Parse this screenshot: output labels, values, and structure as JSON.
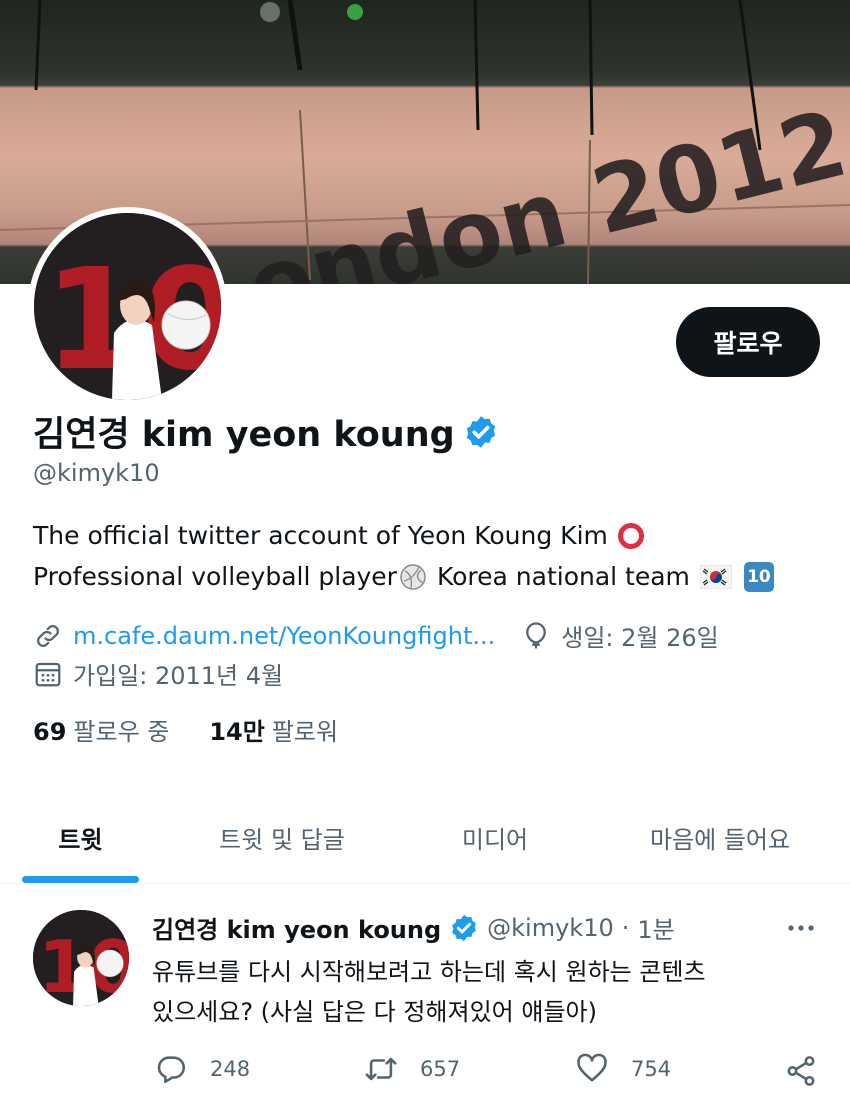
{
  "banner": {
    "text": "London 2012"
  },
  "profile": {
    "avatar_number": "10",
    "follow_label": "팔로우",
    "display_name": "김연경 kim yeon koung",
    "handle": "@kimyk10",
    "bio_line1": "The official twitter account of Yeon Koung Kim",
    "bio_line2a": "Professional volleyball player",
    "bio_line2b": "Korea national team",
    "bio_emoji_ten": "10",
    "website": "m.cafe.daum.net/YeonKoungfight...",
    "birthday": "생일: 2월 26일",
    "joined": "가입일: 2011년 4월",
    "following_count": "69",
    "following_label": "팔로우 중",
    "followers_count": "14만",
    "followers_label": "팔로워"
  },
  "tabs": [
    "트윗",
    "트윗 및 답글",
    "미디어",
    "마음에 들어요"
  ],
  "tweet": {
    "author": "김연경 kim yeon koung",
    "handle": "@kimyk10",
    "dot": "·",
    "time": "1분",
    "text_line1": "유튜브를 다시 시작해보려고 하는데 혹시 원하는 콘텐츠",
    "text_line2": "있으세요? (사실 답은 다 정해져있어 얘들아)",
    "replies": "248",
    "retweets": "657",
    "likes": "754"
  },
  "icons": {
    "verified": "verified-badge-icon",
    "link": "link-icon",
    "birthday": "balloon-icon",
    "calendar": "calendar-icon",
    "reply": "reply-icon",
    "retweet": "retweet-icon",
    "like": "heart-icon",
    "share": "share-icon",
    "more": "more-icon"
  },
  "colors": {
    "accent": "#1d9bf0",
    "text": "#0f1419",
    "muted": "#536471",
    "button": "#0f1419"
  }
}
